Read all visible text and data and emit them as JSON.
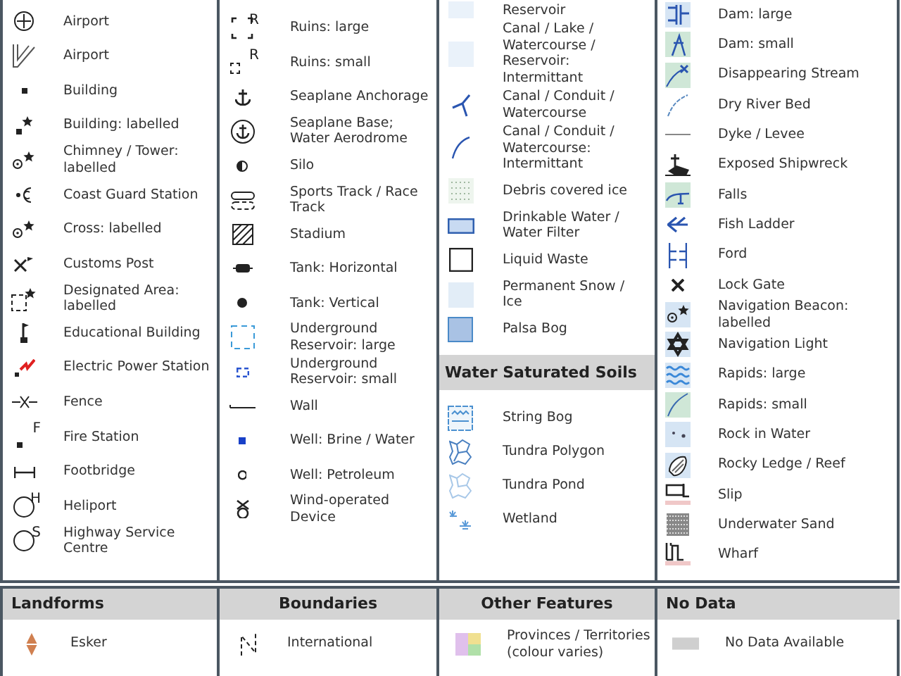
{
  "columns": [
    {
      "sections": [
        {
          "items": [
            {
              "label": "Airport"
            },
            {
              "label": "Airport"
            },
            {
              "label": "Building"
            },
            {
              "label": "Building: labelled"
            },
            {
              "label": "Chimney / Tower: labelled"
            },
            {
              "label": "Coast Guard Station"
            },
            {
              "label": "Cross: labelled"
            },
            {
              "label": "Customs Post"
            },
            {
              "label": "Designated Area: labelled"
            },
            {
              "label": "Educational Building"
            },
            {
              "label": "Electric Power Station"
            },
            {
              "label": "Fence"
            },
            {
              "label": "Fire Station",
              "symbol": "F"
            },
            {
              "label": "Footbridge"
            },
            {
              "label": "Heliport",
              "symbol": "H"
            },
            {
              "label": "Highway Service Centre",
              "symbol": "S"
            }
          ]
        }
      ]
    },
    {
      "sections": [
        {
          "items": [
            {
              "label": "Ruins: large",
              "symbol": "R"
            },
            {
              "label": "Ruins: small",
              "symbol": "R"
            },
            {
              "label": "Seaplane Anchorage"
            },
            {
              "label": "Seaplane Base; Water Aerodrome"
            },
            {
              "label": "Silo"
            },
            {
              "label": "Sports Track / Race Track"
            },
            {
              "label": "Stadium"
            },
            {
              "label": "Tank: Horizontal"
            },
            {
              "label": "Tank: Vertical"
            },
            {
              "label": "Underground Reservoir: large"
            },
            {
              "label": "Underground Reservoir: small"
            },
            {
              "label": "Wall"
            },
            {
              "label": "Well: Brine / Water"
            },
            {
              "label": "Well: Petroleum"
            },
            {
              "label": "Wind-operated Device"
            }
          ]
        }
      ]
    },
    {
      "sections": [
        {
          "items": [
            {
              "label": "Reservoir"
            },
            {
              "label": "Canal / Lake / Watercourse / Reservoir: Intermittant"
            },
            {
              "label": "Canal / Conduit / Watercourse"
            },
            {
              "label": "Canal / Conduit / Watercourse: Intermittant"
            },
            {
              "label": "Debris covered ice"
            },
            {
              "label": "Drinkable Water / Water Filter"
            },
            {
              "label": "Liquid Waste"
            },
            {
              "label": "Permanent Snow / Ice"
            },
            {
              "label": "Palsa Bog"
            }
          ]
        },
        {
          "heading": "Water Saturated Soils",
          "items": [
            {
              "label": "String Bog"
            },
            {
              "label": "Tundra Polygon"
            },
            {
              "label": "Tundra Pond"
            },
            {
              "label": "Wetland"
            }
          ]
        }
      ]
    },
    {
      "sections": [
        {
          "items": [
            {
              "label": "Dam: large"
            },
            {
              "label": "Dam: small"
            },
            {
              "label": "Disappearing Stream"
            },
            {
              "label": "Dry River Bed"
            },
            {
              "label": "Dyke / Levee"
            },
            {
              "label": "Exposed Shipwreck"
            },
            {
              "label": "Falls"
            },
            {
              "label": "Fish Ladder"
            },
            {
              "label": "Ford"
            },
            {
              "label": "Lock Gate"
            },
            {
              "label": "Navigation Beacon: labelled"
            },
            {
              "label": "Navigation Light"
            },
            {
              "label": "Rapids: large"
            },
            {
              "label": "Rapids: small"
            },
            {
              "label": "Rock in Water"
            },
            {
              "label": "Rocky Ledge / Reef"
            },
            {
              "label": "Slip"
            },
            {
              "label": "Underwater Sand"
            },
            {
              "label": "Wharf"
            }
          ]
        }
      ]
    }
  ],
  "bottom": [
    {
      "heading": "Landforms",
      "items": [
        {
          "label": "Esker"
        }
      ]
    },
    {
      "heading": "Boundaries",
      "items": [
        {
          "label": "International"
        }
      ]
    },
    {
      "heading": "Other Features",
      "items": [
        {
          "label": "Provinces / Territories (colour varies)"
        }
      ]
    },
    {
      "heading": "No Data",
      "items": [
        {
          "label": "No Data Available"
        }
      ]
    }
  ]
}
